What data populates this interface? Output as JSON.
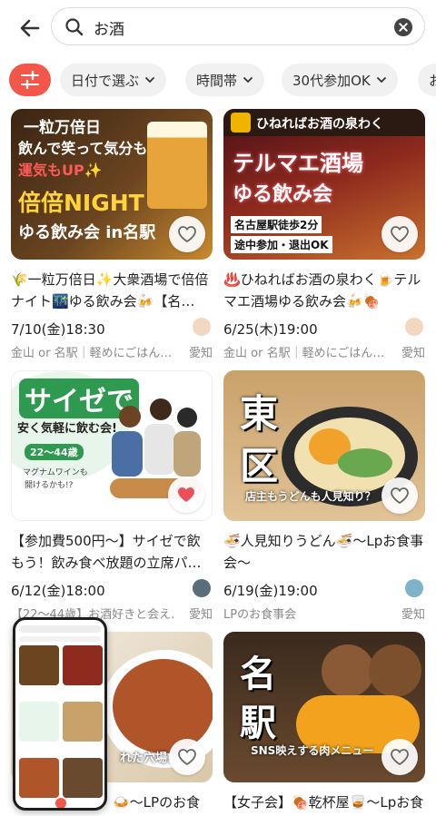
{
  "search": {
    "query": "お酒"
  },
  "filters": [
    {
      "label": "日付で選ぶ"
    },
    {
      "label": "時間帯"
    },
    {
      "label": "30代参加OK"
    },
    {
      "label": "お"
    }
  ],
  "events": [
    {
      "title": "🌾一粒万倍日✨大衆酒場で倍倍ナイト🌃ゆる飲み会🍻【名…",
      "date": "7/10(金)18:30",
      "location": "金山 or 名駅｜軽めにごはん…",
      "pref": "愛知",
      "thumb_lines": [
        "一粒万倍日",
        "飲んで笑って気分も",
        "運気もUP✨",
        "倍倍NIGHT",
        "ゆる飲み会 in名駅"
      ]
    },
    {
      "title": "♨️ひねればお酒の泉わく🍺テルマエ酒場ゆる飲み会🍻🍖",
      "date": "6/25(木)19:00",
      "location": "金山 or 名駅｜軽めにごはん…",
      "pref": "愛知",
      "thumb_lines": [
        "ひねればお酒の泉わく",
        "テルマエ酒場",
        "ゆる飲み会",
        "名古屋駅徒歩2分",
        "途中参加・退出OK"
      ]
    },
    {
      "title": "【参加費500円〜】サイゼで飲もう！飲み食べ放題の立席パ…",
      "date": "6/12(金)18:00",
      "location": "【22〜44歳】お酒好きと会え…",
      "pref": "愛知",
      "thumb_lines": [
        "サイゼで",
        "安く気軽に飲む会!",
        "22〜44歳",
        "マグナムワインも",
        "開けるかも!?"
      ]
    },
    {
      "title": "🍜人見知りうどん🍜〜Lpお食事会〜",
      "date": "6/19(金)19:00",
      "location": "LPのお食事会",
      "pref": "愛知",
      "thumb_lines": [
        "東",
        "区",
        "店主もうどんも人見知り？"
      ]
    },
    {
      "title": "🍛〜LPのお食事",
      "thumb_lines": [
        "れた穴場カ"
      ]
    },
    {
      "title": "【女子会】🍖乾杯屋🥃〜Lpお食事会〜",
      "thumb_lines": [
        "名",
        "駅",
        "SNS映えする肉メニュー"
      ]
    }
  ],
  "colors": {
    "accent": "#f2574a",
    "chip_bg": "#f1f1f1",
    "fav_active": "#e8505b"
  }
}
